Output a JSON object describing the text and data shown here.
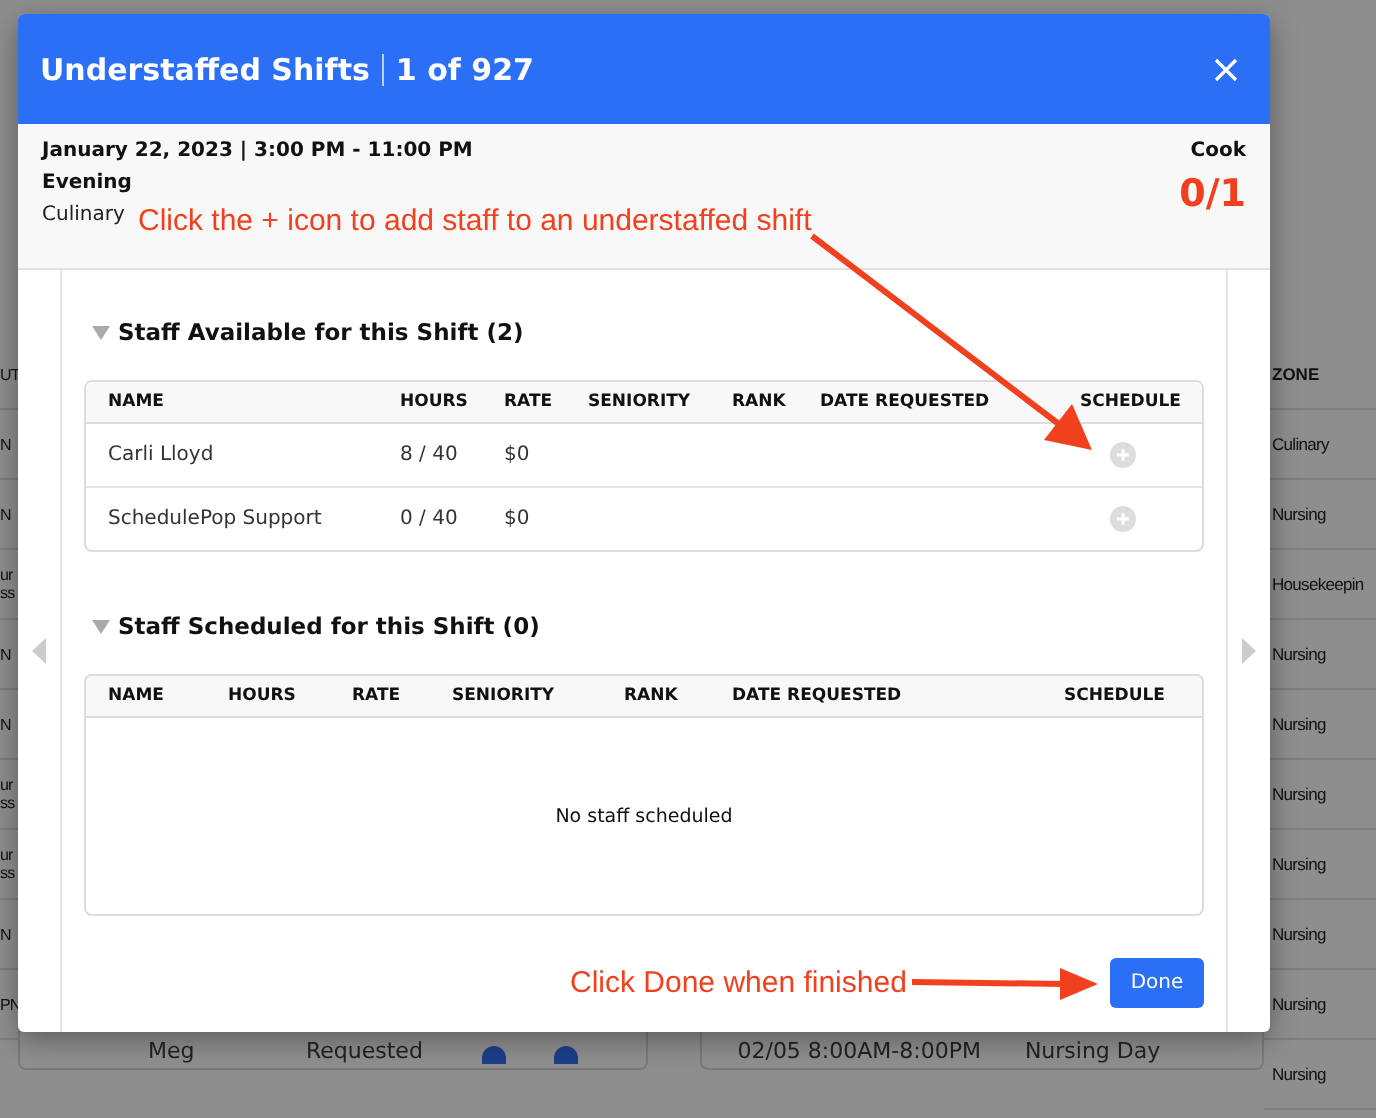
{
  "background": {
    "left_column": [
      "UT",
      "N",
      "N",
      "ur\nss",
      "N",
      "N",
      "ur\nss",
      "ur\nss",
      "N",
      "PN"
    ],
    "zone_column": {
      "header": "ZONE",
      "rows": [
        "Culinary",
        "Nursing",
        "Housekeepin",
        "Nursing",
        "Nursing",
        "Nursing",
        "Nursing",
        "Nursing",
        "Nursing",
        "Nursing"
      ]
    },
    "bottom_left_row": {
      "name": "Meg",
      "status": "Requested"
    },
    "bottom_right_row": {
      "time": "02/05 8:00AM-8:00PM",
      "shift": "Nursing Day"
    }
  },
  "modal": {
    "title": "Understaffed Shifts",
    "counter": "1 of 927",
    "shift": {
      "date_time": "January 22, 2023 | 3:00 PM - 11:00 PM",
      "period": "Evening",
      "department": "Culinary",
      "role": "Cook",
      "filled": "0/1"
    },
    "sections": [
      {
        "title": "Staff Available for this Shift (2)",
        "expanded": true,
        "columns": [
          "NAME",
          "HOURS",
          "RATE",
          "SENIORITY",
          "RANK",
          "DATE REQUESTED",
          "SCHEDULE"
        ],
        "rows": [
          {
            "name": "Carli Lloyd",
            "hours": "8 / 40",
            "rate": "$0"
          },
          {
            "name": "SchedulePop Support",
            "hours": "0 / 40",
            "rate": "$0"
          }
        ]
      },
      {
        "title": "Staff Scheduled for this Shift (0)",
        "expanded": true,
        "columns": [
          "NAME",
          "HOURS",
          "RATE",
          "SENIORITY",
          "RANK",
          "DATE REQUESTED",
          "SCHEDULE"
        ],
        "empty_text": "No staff scheduled"
      }
    ],
    "done_button": "Done"
  },
  "annotations": [
    {
      "text": "Click the + icon to add staff to an understaffed shift"
    },
    {
      "text": "Click Done when finished"
    }
  ]
}
